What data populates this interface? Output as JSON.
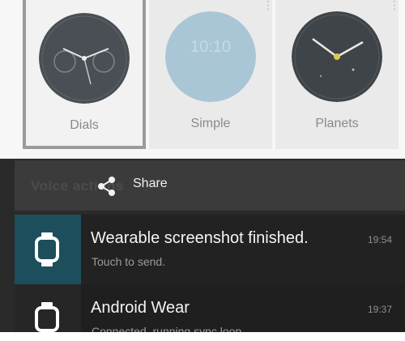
{
  "watch_faces": [
    {
      "label": "Dials",
      "selected": true,
      "dial_color": "#4a4f55"
    },
    {
      "label": "Simple",
      "selected": false,
      "dial_color": "#a9c6d6",
      "time_text": "10:10"
    },
    {
      "label": "Planets",
      "selected": false,
      "dial_color": "#3f4448"
    }
  ],
  "share_bar": {
    "background_text": "Voice actions",
    "share_label": "Share",
    "share_icon": "share-icon"
  },
  "notifications": [
    {
      "title": "Wearable screenshot finished.",
      "subtitle": "Touch to send.",
      "time": "19:54",
      "icon": "watch-icon",
      "icon_bg": "#1c4e5c"
    },
    {
      "title": "Android Wear",
      "subtitle": "Connected, running sync loop",
      "time": "19:37",
      "icon": "watch-icon",
      "icon_bg": "#262626"
    }
  ],
  "colors": {
    "dark_bg": "#2a2a2a",
    "accent_teal": "#1c4e5c",
    "planet_dot": "#d8c94a"
  }
}
